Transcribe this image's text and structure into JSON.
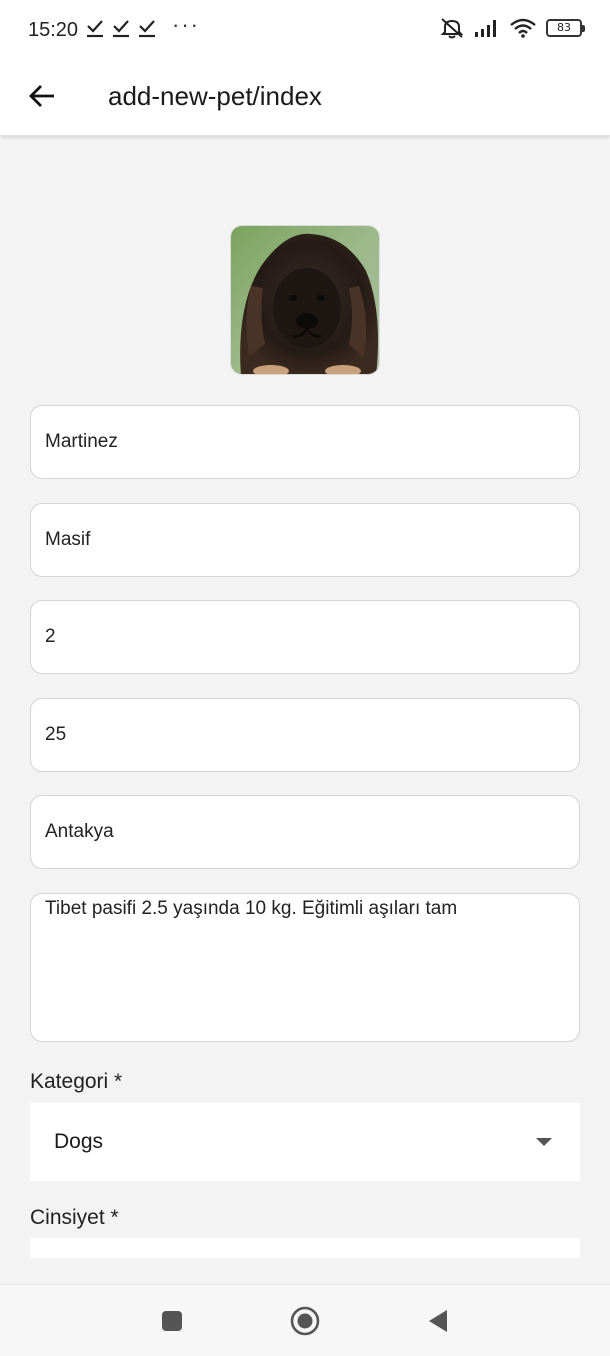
{
  "status_bar": {
    "time": "15:20",
    "overflow": "···",
    "battery": "83",
    "icons": [
      "check-icon",
      "check-icon",
      "check-icon",
      "mute-icon",
      "signal-icon",
      "wifi-icon",
      "battery-icon"
    ]
  },
  "app_bar": {
    "title": "add-new-pet/index",
    "back_icon": "arrow-left-icon"
  },
  "form": {
    "name": "Martinez",
    "breed": "Masif",
    "age": "2",
    "weight": "25",
    "location": "Antakya",
    "about": "Tibet pasifi 2.5 yaşında 10 kg. Eğitimli aşıları tam",
    "category_label": "Kategori *",
    "category_value": "Dogs",
    "gender_label": "Cinsiyet *"
  },
  "nav": {
    "icons": [
      "square-icon",
      "circle-icon",
      "triangle-back-icon"
    ]
  },
  "colors": {
    "background": "#f3f3f3",
    "surface": "#ffffff",
    "border": "#d4d4d4",
    "text": "#1a1a1a"
  }
}
